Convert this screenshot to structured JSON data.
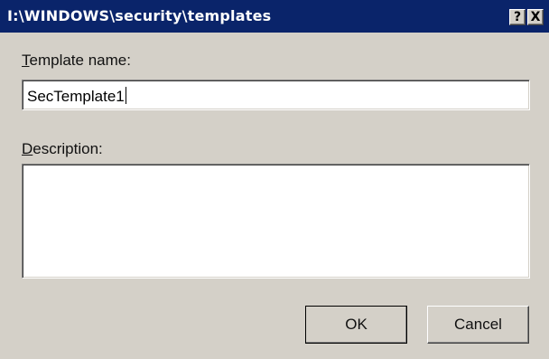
{
  "window": {
    "title": "I:\\WINDOWS\\security\\templates",
    "help_button": "?",
    "close_button": "X"
  },
  "form": {
    "template_name": {
      "label_mnemonic": "T",
      "label_rest": "emplate name:",
      "value": "SecTemplate1"
    },
    "description": {
      "label_mnemonic": "D",
      "label_rest": "escription:",
      "value": ""
    }
  },
  "buttons": {
    "ok_label": "OK",
    "cancel_label": "Cancel"
  },
  "colors": {
    "titlebar": "#0a246a",
    "dialog_face": "#d4d0c8"
  }
}
